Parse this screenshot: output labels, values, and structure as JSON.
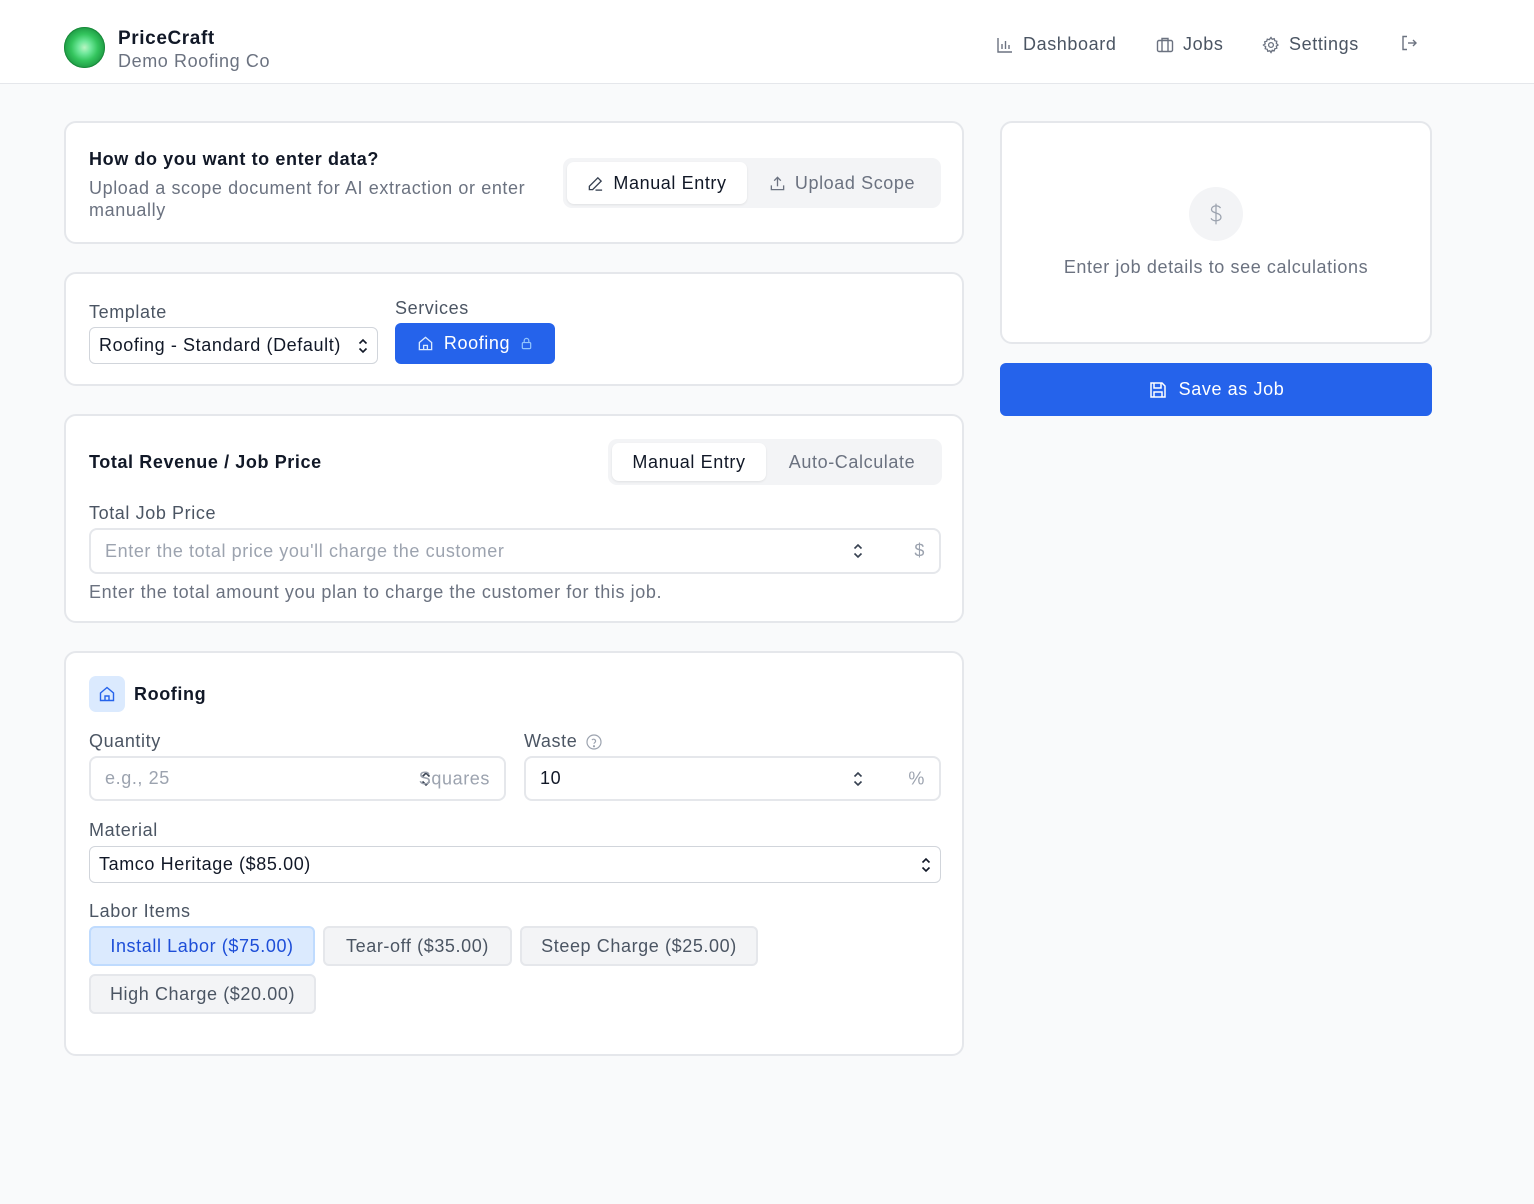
{
  "header": {
    "app_name": "PriceCraft",
    "company": "Demo Roofing Co",
    "nav": {
      "dashboard": "Dashboard",
      "jobs": "Jobs",
      "settings": "Settings"
    }
  },
  "entry_mode": {
    "title": "How do you want to enter data?",
    "description": "Upload a scope document for AI extraction or enter manually",
    "manual_label": "Manual Entry",
    "upload_label": "Upload Scope",
    "selected": "Manual Entry"
  },
  "template": {
    "label": "Template",
    "value": "Roofing - Standard (Default)",
    "services_label": "Services",
    "service_chip": "Roofing"
  },
  "revenue": {
    "title": "Total Revenue / Job Price",
    "manual_label": "Manual Entry",
    "auto_label": "Auto-Calculate",
    "selected": "Manual Entry",
    "field_label": "Total Job Price",
    "placeholder": "Enter the total price you'll charge the customer",
    "suffix": "$",
    "help": "Enter the total amount you plan to charge the customer for this job."
  },
  "roofing": {
    "title": "Roofing",
    "quantity_label": "Quantity",
    "quantity_placeholder": "e.g., 25",
    "quantity_suffix": "Squares",
    "waste_label": "Waste",
    "waste_value": "10",
    "waste_suffix": "%",
    "material_label": "Material",
    "material_value": "Tamco Heritage ($85.00)",
    "labor_label": "Labor Items",
    "labor_items": [
      {
        "label": "Install Labor ($75.00)",
        "selected": true
      },
      {
        "label": "Tear-off ($35.00)",
        "selected": false
      },
      {
        "label": "Steep Charge ($25.00)",
        "selected": false
      },
      {
        "label": "High Charge ($20.00)",
        "selected": false
      }
    ]
  },
  "summary": {
    "empty_text": "Enter job details to see calculations",
    "save_label": "Save as Job"
  },
  "colors": {
    "primary": "#2563eb",
    "chip_active_bg": "#dbeafe",
    "border": "#e5e7eb"
  }
}
